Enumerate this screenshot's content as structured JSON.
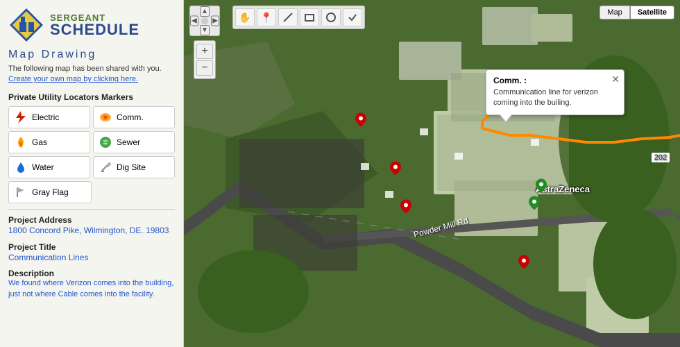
{
  "app": {
    "name": "Sergeant Schedule",
    "logo_top": "SERGEANT",
    "logo_bottom": "SCHEDULE"
  },
  "sidebar": {
    "title": "Map Drawing",
    "description": "The following map has been shared with you.",
    "create_text": "Create your own map by clicking here.",
    "markers_section": "Private Utility Locators Markers",
    "markers": [
      {
        "id": "electric",
        "label": "Electric",
        "icon": "⚡",
        "color": "#cc0000"
      },
      {
        "id": "comm",
        "label": "Comm.",
        "icon": "📞",
        "color": "#ff8800"
      },
      {
        "id": "gas",
        "label": "Gas",
        "icon": "🔥",
        "color": "#ffaa00"
      },
      {
        "id": "sewer",
        "label": "Sewer",
        "icon": "🌿",
        "color": "#228B22"
      },
      {
        "id": "water",
        "label": "Water",
        "icon": "💧",
        "color": "#1a6adb"
      },
      {
        "id": "digsite",
        "label": "Dig Site",
        "icon": "⛏",
        "color": "#888"
      }
    ],
    "gray_flag": "Gray Flag",
    "project_address_label": "Project Address",
    "project_address_value": "1800 Concord Pike, Wilmington, DE. 19803",
    "project_title_label": "Project Title",
    "project_title_value": "Communication Lines",
    "description_label": "Description",
    "description_value": "We found where Verizon comes into the building, just not where Cable comes into the facility."
  },
  "map": {
    "view_mode": "Satellite",
    "popup": {
      "title": "Comm. :",
      "body": "Communication line for verizon coming into the builing."
    },
    "label_astrazeneca": "AstraZeneca",
    "label_road": "Powder Mill Rd",
    "label_202": "202"
  },
  "toolbar": {
    "buttons": [
      "✋",
      "📍",
      "✏️",
      "⬜",
      "⭕",
      "✔️"
    ]
  }
}
